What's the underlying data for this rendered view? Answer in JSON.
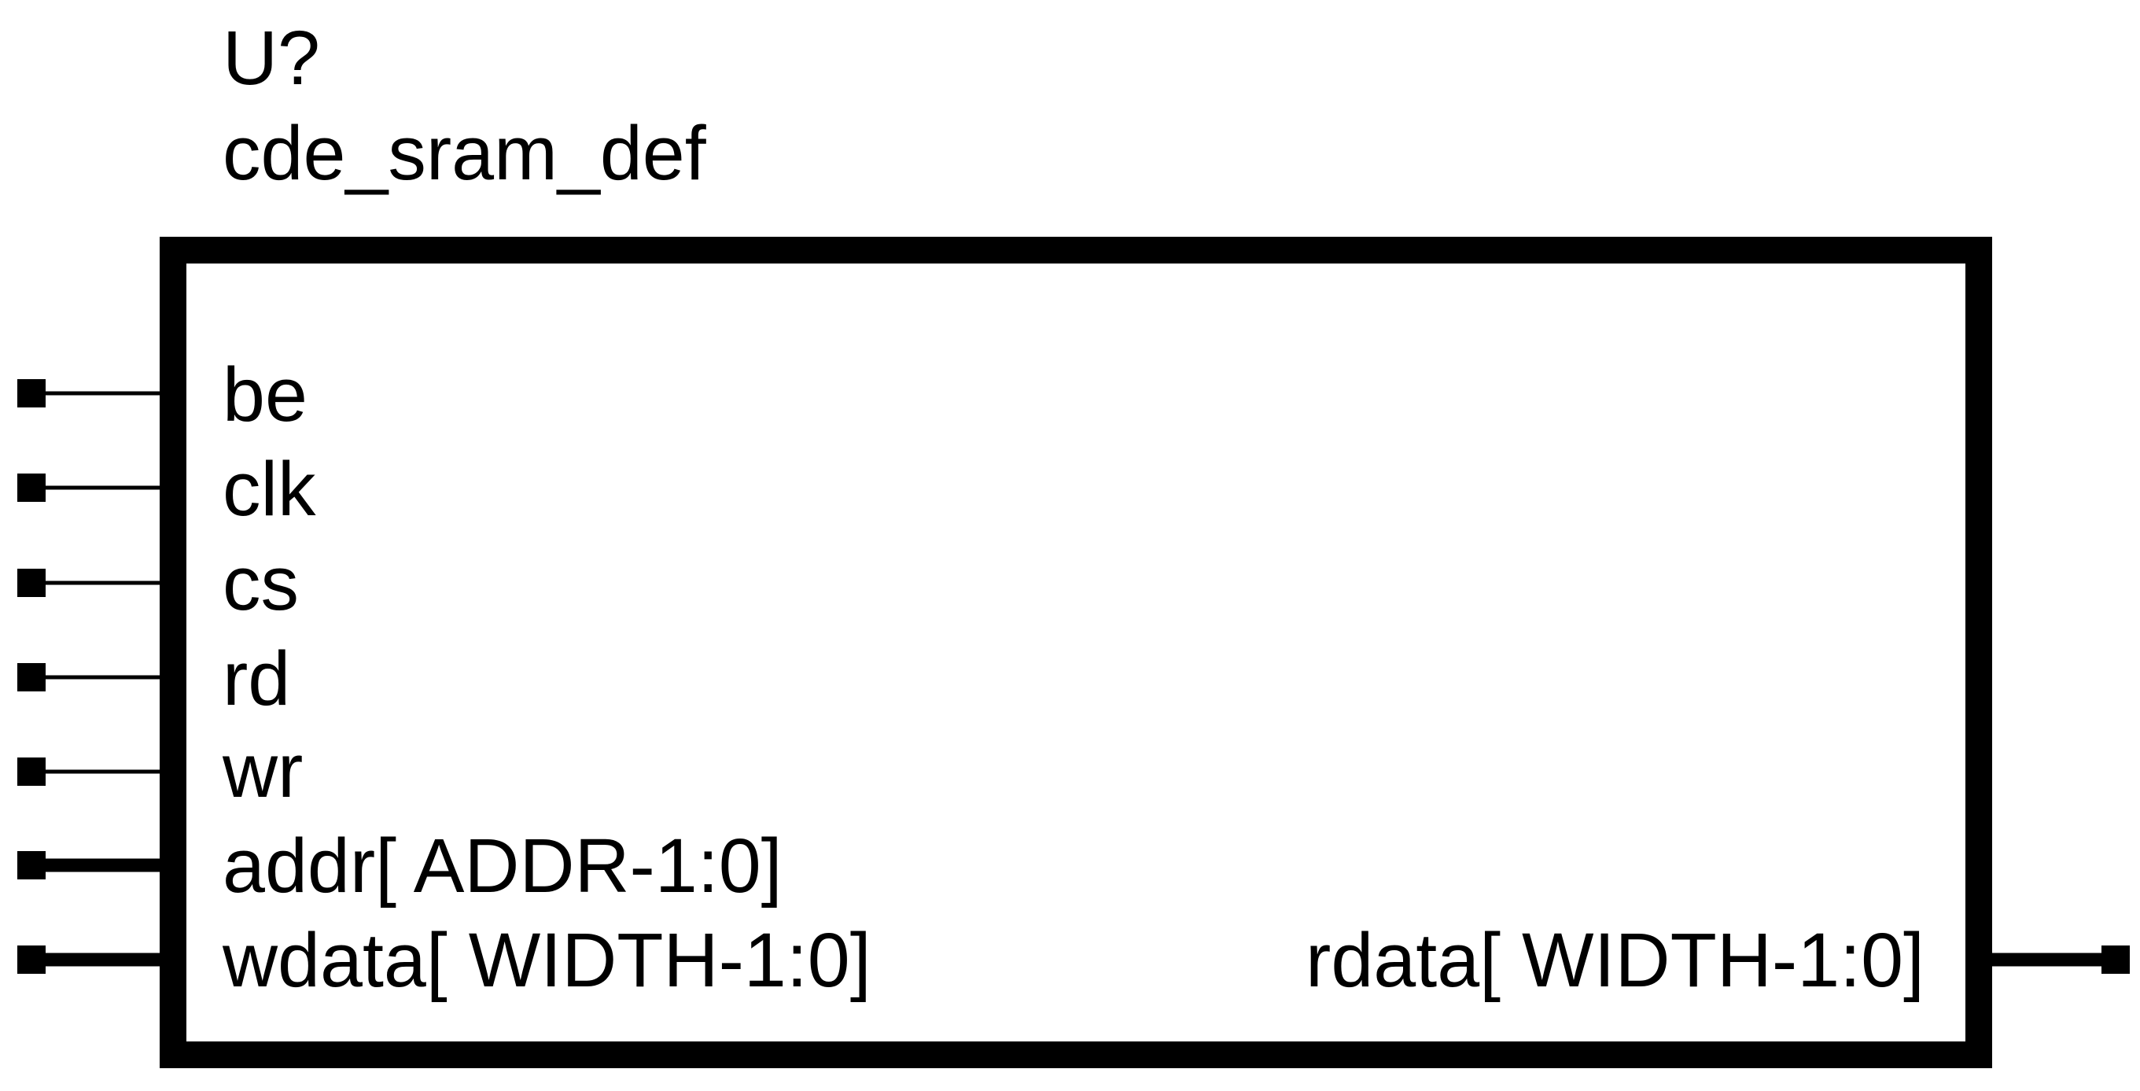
{
  "symbol": {
    "reference": "U?",
    "name": "cde_sram_def"
  },
  "pins": {
    "left": [
      {
        "label": "be",
        "bus": false
      },
      {
        "label": "clk",
        "bus": false
      },
      {
        "label": "cs",
        "bus": false
      },
      {
        "label": "rd",
        "bus": false
      },
      {
        "label": "wr",
        "bus": false
      },
      {
        "label": "addr[ ADDR-1:0]",
        "bus": true
      },
      {
        "label": "wdata[ WIDTH-1:0]",
        "bus": true
      }
    ],
    "right": [
      {
        "label": "rdata[ WIDTH-1:0]",
        "bus": true
      }
    ]
  },
  "colors": {
    "line": "#000000",
    "background": "#ffffff"
  }
}
